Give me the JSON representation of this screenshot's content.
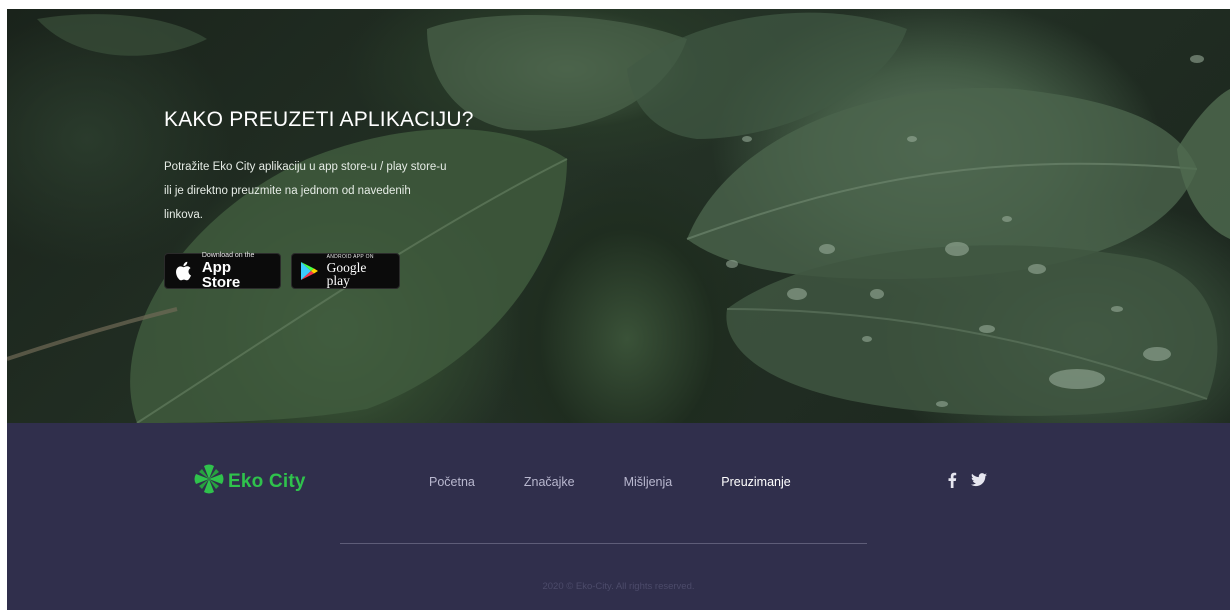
{
  "hero": {
    "title": "KAKO PREUZETI APLIKACIJU?",
    "description": "Potražite Eko City aplikaciju u app store-u / play store-u ili je direktno preuzmite na jednom od navedenih linkova.",
    "app_store": {
      "small": "Download on the",
      "big": "App Store",
      "icon": "apple-icon"
    },
    "google_play": {
      "small": "ANDROID APP ON",
      "big": "Google play",
      "icon": "google-play-icon"
    }
  },
  "footer": {
    "logo_text": "Eko City",
    "logo_icon": "leaf-flower-icon",
    "nav": [
      "Početna",
      "Značajke",
      "Mišljenja",
      "Preuzimanje"
    ],
    "active_nav": "Preuzimanje",
    "social": [
      "facebook-icon",
      "twitter-icon"
    ],
    "copyright": "2020 © Eko-City. All rights reserved."
  },
  "colors": {
    "footer_bg": "#302f4c",
    "brand_green": "#2fc24c",
    "nav_text": "#b9b8cf",
    "nav_active": "#ffffff"
  }
}
